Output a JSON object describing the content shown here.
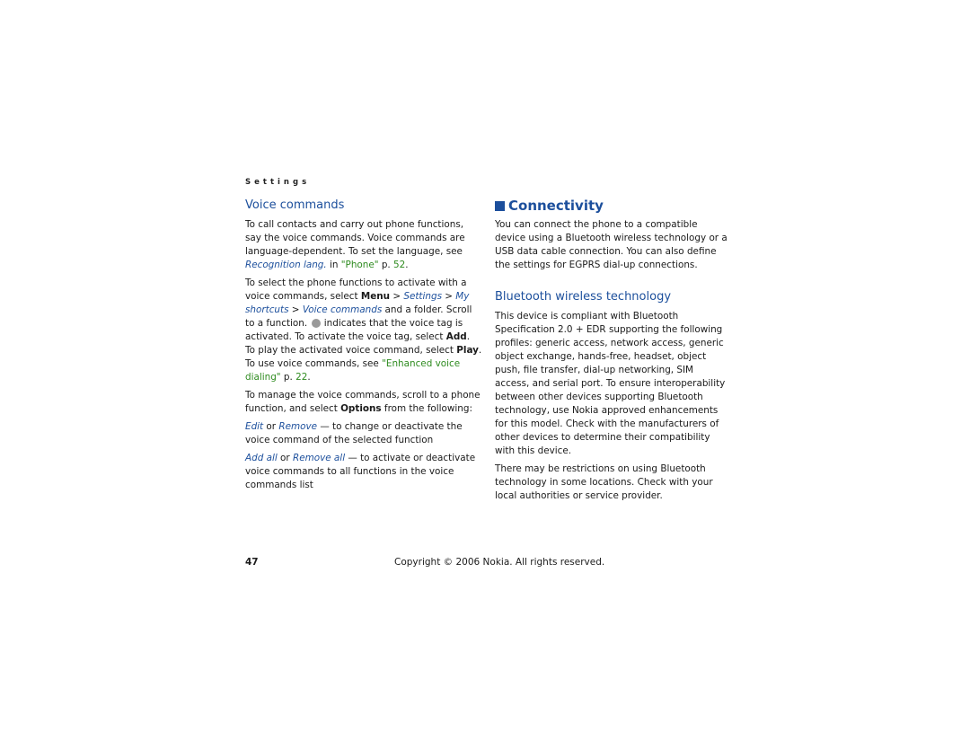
{
  "running_head": "Settings",
  "left": {
    "heading": "Voice commands",
    "p1": {
      "text": "To call contacts and carry out phone functions, say the voice commands. Voice commands are language-dependent. To set the language, see ",
      "link1": "Recognition lang.",
      "mid": " in ",
      "link2": "\"Phone\"",
      "tail": " p. ",
      "page": "52",
      "end": "."
    },
    "p2": {
      "t1": "To select the phone functions to activate with a voice commands, select ",
      "menu": "Menu",
      "sep1": " > ",
      "settings": "Settings",
      "sep2": " > ",
      "shortcuts": "My shortcuts",
      "sep3": " > ",
      "voice": "Voice commands",
      "t2": " and a folder. Scroll to a function. ",
      "icon": "voice-tag-icon",
      "t3": " indicates that the voice tag is activated. To activate the voice tag, select ",
      "add": "Add",
      "t4": ". To play the activated voice command, select ",
      "play": "Play",
      "t5": ". To use voice commands, see ",
      "link": "\"Enhanced voice dialing\"",
      "t6": " p. ",
      "page": "22",
      "end": "."
    },
    "p3": {
      "t1": "To manage the voice commands, scroll to a phone function, and select ",
      "options": "Options",
      "t2": " from the following:"
    },
    "p4": {
      "opt1": "Edit",
      "or": " or ",
      "opt2": "Remove",
      "desc": " — to change or deactivate the voice command of the selected function"
    },
    "p5": {
      "opt1": "Add all",
      "or": " or ",
      "opt2": "Remove all",
      "desc": " — to activate or deactivate voice commands to all functions in the voice commands list"
    }
  },
  "right": {
    "heading": "Connectivity",
    "intro": "You can connect the phone to a compatible device using a Bluetooth wireless technology or a USB data cable connection. You can also define the settings for EGPRS dial-up connections.",
    "subheading": "Bluetooth wireless technology",
    "p1": "This device is compliant with Bluetooth Specification 2.0 + EDR supporting the following profiles: generic access, network access, generic object exchange, hands-free, headset, object push, file transfer, dial-up networking, SIM access, and serial port. To ensure interoperability between other devices supporting Bluetooth technology, use Nokia approved enhancements for this model. Check with the manufacturers of other devices to determine their compatibility with this device.",
    "p2": "There may be restrictions on using Bluetooth technology in some locations. Check with your local authorities or service provider."
  },
  "footer": {
    "page_number": "47",
    "copyright": "Copyright © 2006 Nokia. All rights reserved."
  }
}
